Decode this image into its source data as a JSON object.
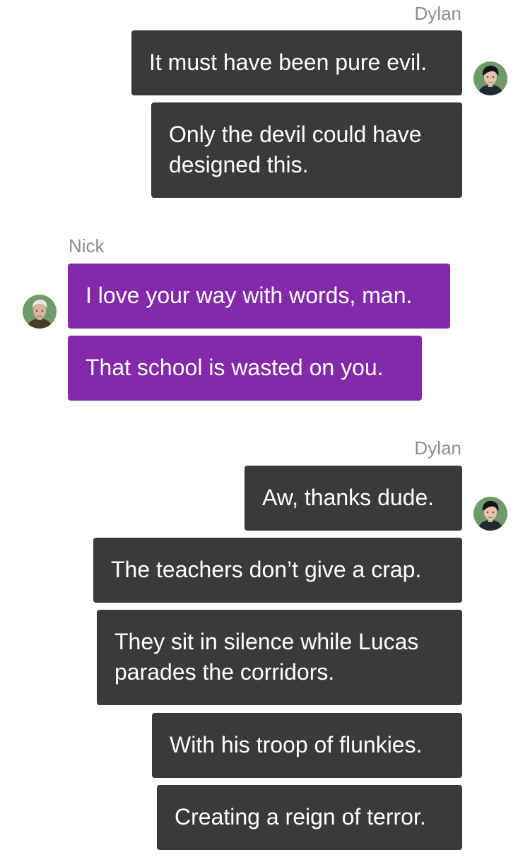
{
  "conversation": {
    "groups": [
      {
        "sender": "Dylan",
        "avatar_icon": "dylan-avatar-icon",
        "messages": [
          "It must have been pure evil.",
          "Only the devil could have designed this."
        ]
      },
      {
        "sender": "Nick",
        "avatar_icon": "nick-avatar-icon",
        "messages": [
          "I love your way with words, man.",
          "That school is wasted on you."
        ]
      },
      {
        "sender": "Dylan",
        "avatar_icon": "dylan-avatar-icon",
        "messages": [
          "Aw, thanks dude.",
          "The teachers don’t give a crap.",
          "They sit in silence while Lucas parades the corridors.",
          "With his troop of flunkies.",
          "Creating a reign of terror."
        ]
      }
    ]
  },
  "colors": {
    "sent_bubble": "#3a3a3a",
    "received_bubble": "#8429a9",
    "sender_name": "#8e8e8e",
    "background": "#ffffff"
  }
}
